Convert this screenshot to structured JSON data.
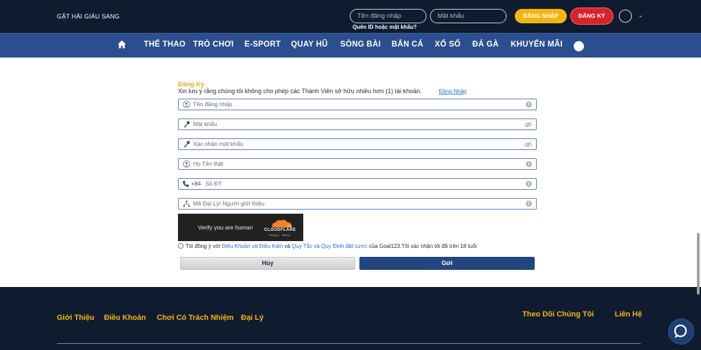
{
  "header": {
    "brand": "GẶT HÁI GIÀU SANG",
    "username_placeholder": "Tên đăng nhập",
    "password_placeholder": "Mật khẩu",
    "forgot_label": "Quên ID hoặc mật khẩu?",
    "login_label": "ĐĂNG NHẬP",
    "register_label": "ĐĂNG KÝ"
  },
  "nav": {
    "items": [
      "THỂ THAO",
      "TRÒ CHƠI",
      "E-SPORT",
      "QUAY HŨ",
      "SÒNG BÀI",
      "BẮN CÁ",
      "XỔ SỐ",
      "ĐÁ GÀ",
      "KHUYẾN MÃI"
    ]
  },
  "form": {
    "title": "Đăng Ký",
    "notice": "Xin lưu ý rằng chúng tôi không cho phép các Thành Viên sở hữu nhiều hơn (1) tài khoản.",
    "notice_link": "Đăng Nhập",
    "fields": {
      "username": "Tên đăng nhập",
      "password": "Mật khẩu",
      "confirm_password": "Xác nhận mật khẩu",
      "fullname": "Họ Tên thật",
      "phone_prefix": "+84",
      "phone": "Số ĐT",
      "referral": "Mã Đại Lý/ Người giới thiệu"
    },
    "captcha": {
      "text": "Verify you are human",
      "brand": "CLOUDFLARE",
      "links": "Privacy · Terms"
    },
    "agree": {
      "prefix": "Tôi đồng ý với",
      "terms_link": "Điều Khoản và Điều Kiện",
      "and": "và",
      "rules_link": "Quy Tắc và Quy Định đặt cược",
      "suffix": "của Goal123.Tôi xác nhận tôi đã trên 18 tuổi"
    },
    "cancel_label": "Hủy",
    "submit_label": "Gửi"
  },
  "footer": {
    "links": [
      "Giới Thiệu",
      "Điều Khoản",
      "Chơi Có Trách Nhiệm",
      "Đại Lý"
    ],
    "follow_label": "Theo Dõi Chúng Tôi",
    "contact_label": "Liên Hệ"
  },
  "colors": {
    "header_bg": "#0f1c30",
    "nav_bg": "#2a4e8e",
    "accent_yellow": "#f5b50f",
    "accent_red": "#d8232a",
    "submit_blue": "#23457f"
  }
}
